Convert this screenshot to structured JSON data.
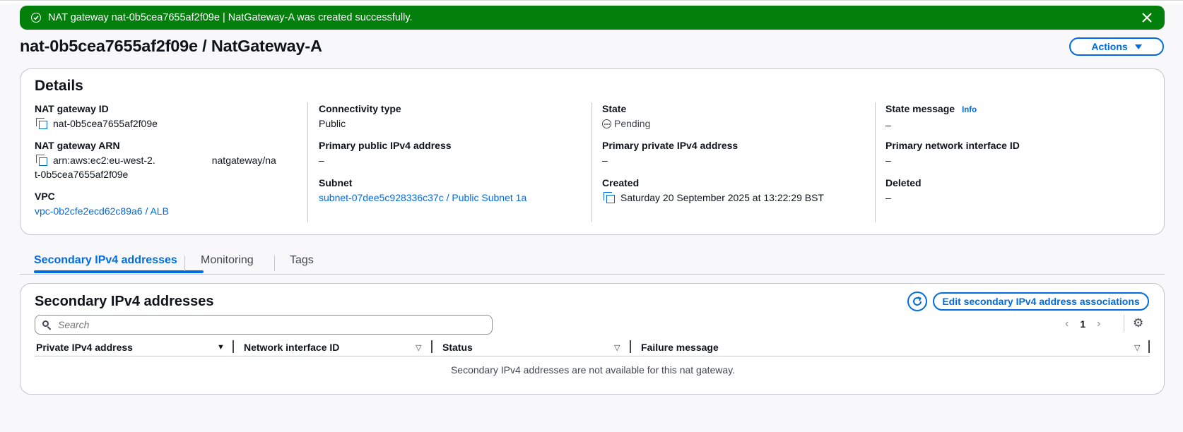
{
  "flash": {
    "message": "NAT gateway nat-0b5cea7655af2f09e | NatGateway-A was created successfully."
  },
  "page": {
    "title": "nat-0b5cea7655af2f09e / NatGateway-A",
    "actions_label": "Actions"
  },
  "details": {
    "heading": "Details",
    "nat_gateway_id_label": "NAT gateway ID",
    "nat_gateway_id": "nat-0b5cea7655af2f09e",
    "nat_gateway_arn_label": "NAT gateway ARN",
    "nat_gateway_arn_prefix": "arn:aws:ec2:eu-west-2.",
    "nat_gateway_arn_suffix": "natgateway/na",
    "nat_gateway_arn_line2": "t-0b5cea7655af2f09e",
    "vpc_label": "VPC",
    "vpc_value": "vpc-0b2cfe2ecd62c89a6 / ALB",
    "connectivity_type_label": "Connectivity type",
    "connectivity_type": "Public",
    "primary_public_ipv4_label": "Primary public IPv4 address",
    "primary_public_ipv4": "–",
    "subnet_label": "Subnet",
    "subnet_value": "subnet-07dee5c928336c37c / Public Subnet 1a",
    "state_label": "State",
    "state_value": "Pending",
    "primary_private_ipv4_label": "Primary private IPv4 address",
    "primary_private_ipv4": "–",
    "created_label": "Created",
    "created_value": "Saturday 20 September 2025 at 13:22:29 BST",
    "state_message_label": "State message",
    "info_label": "Info",
    "state_message": "–",
    "primary_network_interface_label": "Primary network interface ID",
    "primary_network_interface": "–",
    "deleted_label": "Deleted",
    "deleted_value": "–"
  },
  "tabs": [
    {
      "label": "Secondary IPv4 addresses",
      "active": true
    },
    {
      "label": "Monitoring",
      "active": false
    },
    {
      "label": "Tags",
      "active": false
    }
  ],
  "secondary": {
    "heading": "Secondary IPv4 addresses",
    "edit_label": "Edit secondary IPv4 address associations",
    "search_placeholder": "Search",
    "page_number": "1",
    "columns": [
      "Private IPv4 address",
      "Network interface ID",
      "Status",
      "Failure message"
    ],
    "empty_message": "Secondary IPv4 addresses are not available for this nat gateway."
  },
  "colors": {
    "success": "#037f0c",
    "link": "#006ce0",
    "border": "#c6c6cd",
    "background": "#f8f8fa"
  },
  "icons": [
    "success-check-icon",
    "close-icon",
    "caret-down-icon",
    "copy-icon",
    "pending-icon",
    "search-icon",
    "refresh-icon",
    "chevron-left-icon",
    "chevron-right-icon",
    "gear-icon",
    "sort-icon"
  ]
}
